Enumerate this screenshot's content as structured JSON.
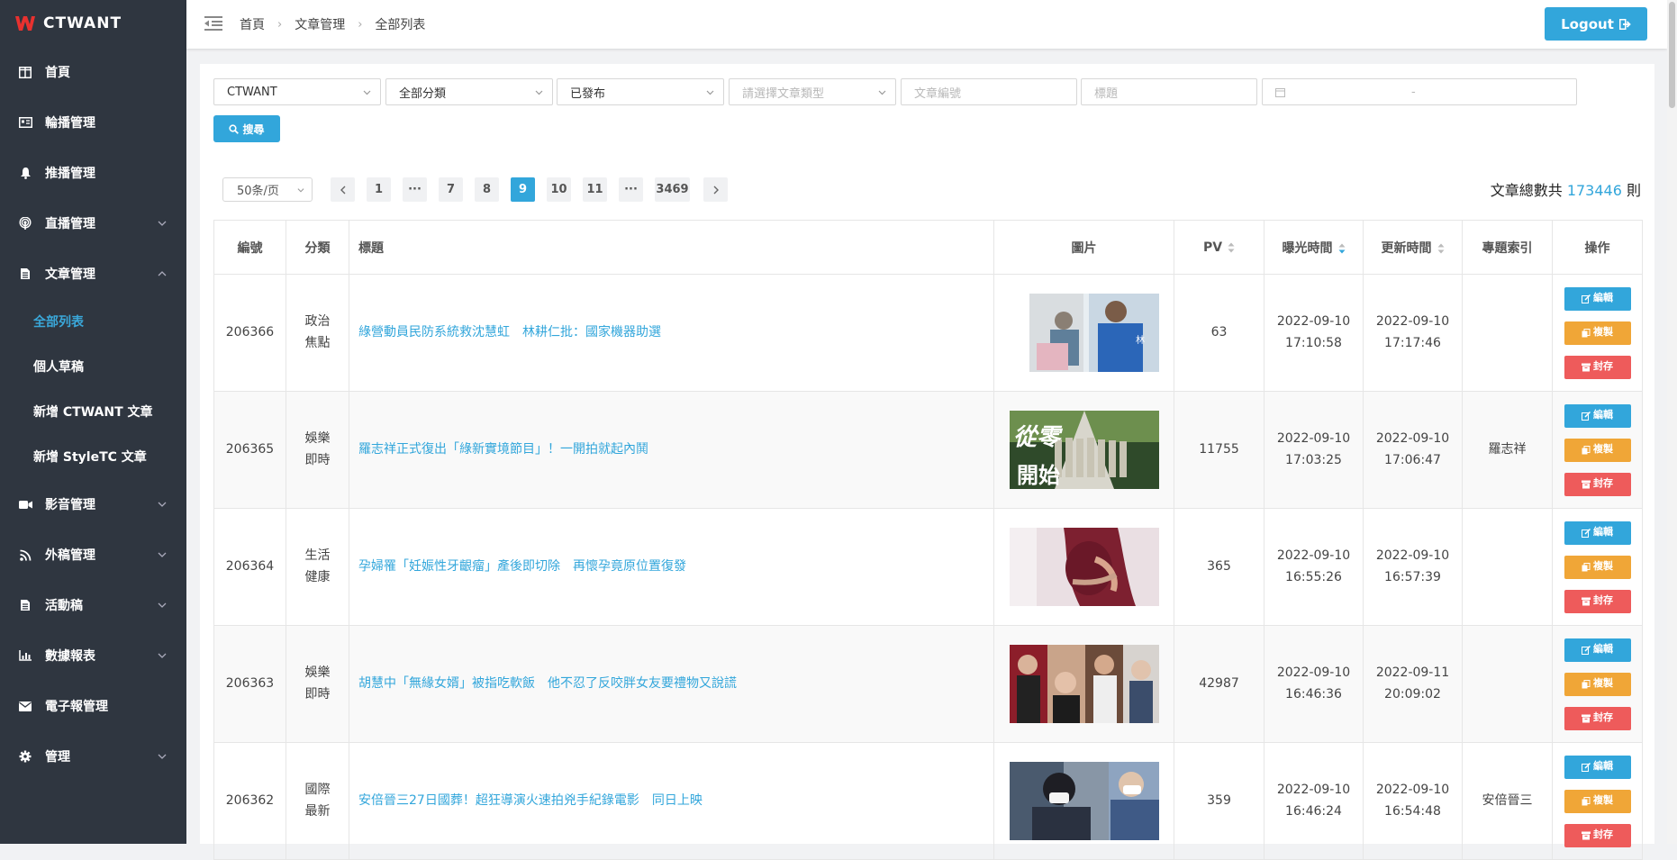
{
  "app": {
    "name": "CTWANT"
  },
  "sidebar": {
    "items": [
      {
        "label": "首頁",
        "icon": "columns-icon"
      },
      {
        "label": "輪播管理",
        "icon": "id-card-icon"
      },
      {
        "label": "推播管理",
        "icon": "bell-icon"
      },
      {
        "label": "直播管理",
        "icon": "broadcast-icon"
      },
      {
        "label": "文章管理",
        "icon": "file-icon"
      },
      {
        "label": "影音管理",
        "icon": "video-icon"
      },
      {
        "label": "外稿管理",
        "icon": "rss-icon"
      },
      {
        "label": "活動稿",
        "icon": "file-icon"
      },
      {
        "label": "數據報表",
        "icon": "bar-chart-icon"
      },
      {
        "label": "電子報管理",
        "icon": "envelope-icon"
      },
      {
        "label": "管理",
        "icon": "gear-icon"
      }
    ],
    "subitems": [
      "全部列表",
      "個人草稿",
      "新增 CTWANT 文章",
      "新增 StyleTC 文章"
    ]
  },
  "header": {
    "breadcrumb": [
      "首頁",
      "文章管理",
      "全部列表"
    ],
    "logout_label": "Logout"
  },
  "filters": {
    "site": "CTWANT",
    "category": "全部分類",
    "status": "已發布",
    "type_placeholder": "請選擇文章類型",
    "id_placeholder": "文章編號",
    "title_placeholder": "標題",
    "date_separator": "-",
    "search_label": "搜尋"
  },
  "pagination": {
    "per_page": "50条/页",
    "pages": [
      "1",
      "···",
      "7",
      "8",
      "9",
      "10",
      "11",
      "···",
      "3469"
    ],
    "current": "9"
  },
  "summary": {
    "prefix": "文章總數共",
    "count": "173446",
    "suffix": "則"
  },
  "table": {
    "headers": {
      "id": "編號",
      "category": "分類",
      "title": "標題",
      "image": "圖片",
      "pv": "PV",
      "exposure": "曝光時間",
      "updated": "更新時間",
      "topic": "專題索引",
      "ops": "操作"
    },
    "actions": {
      "edit": "編輯",
      "copy": "複製",
      "archive": "封存"
    },
    "rows": [
      {
        "id": "206366",
        "cat1": "政治",
        "cat2": "焦點",
        "title": "綠營動員民防系統救沈慧虹　林耕仁批：國家機器助選",
        "pv": "63",
        "exp_date": "2022-09-10",
        "exp_time": "17:10:58",
        "upd_date": "2022-09-10",
        "upd_time": "17:17:46",
        "topic": ""
      },
      {
        "id": "206365",
        "cat1": "娛樂",
        "cat2": "即時",
        "title": "羅志祥正式復出「綠新實境節目」！一開拍就起內鬨",
        "pv": "11755",
        "exp_date": "2022-09-10",
        "exp_time": "17:03:25",
        "upd_date": "2022-09-10",
        "upd_time": "17:06:47",
        "topic": "羅志祥"
      },
      {
        "id": "206364",
        "cat1": "生活",
        "cat2": "健康",
        "title": "孕婦罹「妊娠性牙齦瘤」產後即切除　再懷孕竟原位置復發",
        "pv": "365",
        "exp_date": "2022-09-10",
        "exp_time": "16:55:26",
        "upd_date": "2022-09-10",
        "upd_time": "16:57:39",
        "topic": ""
      },
      {
        "id": "206363",
        "cat1": "娛樂",
        "cat2": "即時",
        "title": "胡慧中「無緣女婿」被指吃軟飯　他不忍了反咬胖女友要禮物又說謊",
        "pv": "42987",
        "exp_date": "2022-09-10",
        "exp_time": "16:46:36",
        "upd_date": "2022-09-11",
        "upd_time": "20:09:02",
        "topic": ""
      },
      {
        "id": "206362",
        "cat1": "國際",
        "cat2": "最新",
        "title": "安倍晉三27日國葬！超狂導演火速拍兇手紀錄電影　同日上映",
        "pv": "359",
        "exp_date": "2022-09-10",
        "exp_time": "16:46:24",
        "upd_date": "2022-09-10",
        "upd_time": "16:54:48",
        "topic": "安倍晉三"
      }
    ]
  },
  "colors": {
    "accent": "#32a6db",
    "sidebar": "#2f3640",
    "copy": "#f0a637",
    "archive": "#ee5b5b",
    "brand": "#e8312f"
  }
}
